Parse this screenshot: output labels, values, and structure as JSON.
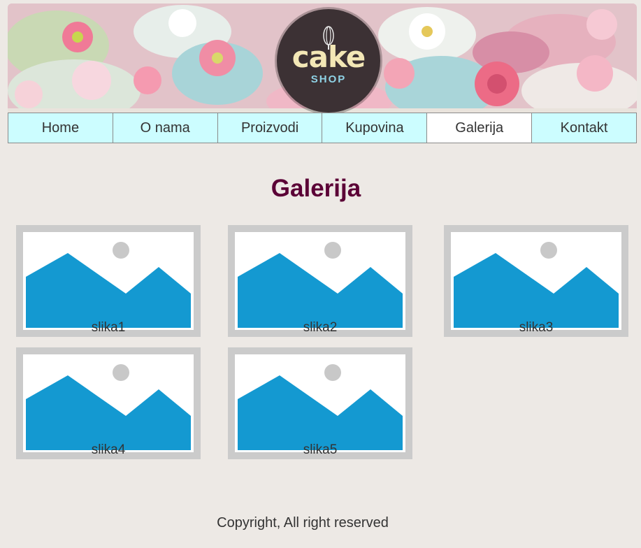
{
  "header": {
    "logo_main": "cake",
    "logo_sub": "SHOP"
  },
  "nav": {
    "items": [
      {
        "label": "Home",
        "active": false
      },
      {
        "label": "O nama",
        "active": false
      },
      {
        "label": "Proizvodi",
        "active": false
      },
      {
        "label": "Kupovina",
        "active": false
      },
      {
        "label": "Galerija",
        "active": true
      },
      {
        "label": "Kontakt",
        "active": false
      }
    ]
  },
  "main": {
    "title": "Galerija",
    "gallery": [
      {
        "caption": "slika1",
        "icon": "image-placeholder-icon"
      },
      {
        "caption": "slika2",
        "icon": "image-placeholder-icon"
      },
      {
        "caption": "slika3",
        "icon": "image-placeholder-icon"
      },
      {
        "caption": "slika4",
        "icon": "image-placeholder-icon"
      },
      {
        "caption": "slika5",
        "icon": "image-placeholder-icon"
      }
    ]
  },
  "footer": {
    "text": "Copyright, All right reserved"
  },
  "colors": {
    "background": "#ede9e5",
    "nav_background": "#ccfdff",
    "nav_active": "#ffffff",
    "title": "#5b0036",
    "placeholder_blue": "#1499d1",
    "placeholder_frame": "#cbcbcb"
  }
}
